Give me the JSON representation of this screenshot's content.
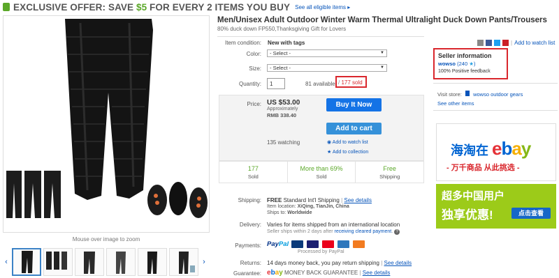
{
  "banner": {
    "prefix": "EXCLUSIVE OFFER: SAVE ",
    "amount": "$5",
    "suffix": " FOR EVERY 2 ITEMS YOU BUY",
    "link": "See all eligible items ▸"
  },
  "gallery": {
    "zoom_hint": "Mouse over image to zoom",
    "thumb_count": 7,
    "selected_thumb": 0
  },
  "item": {
    "title": "Men/Unisex Adult Outdoor Winter Warm Thermal Ultralight Duck Down Pants/Trousers",
    "subtitle": "80% duck down FP550,Thanksgiving Gift for Lovers",
    "share_watch": "Add to watch list",
    "condition_label": "Item condition:",
    "condition_value": "New with tags",
    "color_label": "Color:",
    "color_value": "- Select -",
    "size_label": "Size:",
    "size_value": "- Select -",
    "quantity_label": "Quantity:",
    "quantity_value": "1",
    "available": "81 available",
    "sold": "177 sold"
  },
  "price": {
    "label": "Price:",
    "value": "US $53.00",
    "approx": "Approximately",
    "rmb": "RMB 338.40",
    "buy_now": "Buy It Now",
    "add_to_cart": "Add to cart",
    "watching": "135 watching",
    "add_watch": "Add to watch list",
    "add_collection": "Add to collection"
  },
  "stats": [
    {
      "n": "177",
      "t": "Sold"
    },
    {
      "n": "More than 69%",
      "t": "Sold"
    },
    {
      "n": "Free",
      "t": "Shipping"
    }
  ],
  "shipping": {
    "label": "Shipping:",
    "free": "FREE",
    "method": "Standard Int'l Shipping",
    "details": "See details",
    "location_label": "Item location:",
    "location": "XiQing, TianJin, China",
    "ships_to_label": "Ships to:",
    "ships_to": "Worldwide"
  },
  "delivery": {
    "label": "Delivery:",
    "line1": "Varies for items shipped from an international location",
    "line2_prefix": "Seller ships within 2 days after ",
    "line2_link": "receiving cleared payment",
    "line2_suffix": "."
  },
  "payments": {
    "label": "Payments:",
    "paypal": "Pay",
    "paypal2": "Pal",
    "processed": "Processed by PayPal"
  },
  "returns": {
    "label": "Returns:",
    "text": "14 days money back, you pay return shipping",
    "details": "See details"
  },
  "guarantee": {
    "label": "Guarantee:",
    "text": "MONEY BACK GUARANTEE",
    "details": "See details"
  },
  "seller": {
    "heading": "Seller information",
    "name": "wowso",
    "score": "(240",
    "score_end": ")",
    "feedback": "100% Positive feedback",
    "visit_label": "Visit store:",
    "store_name": "wowso outdoor gears",
    "see_other": "See other items"
  },
  "ads": {
    "ad1_cn": "海淘在",
    "ad1_ebay": "ebay",
    "ad1_sub": "- 万千商品 从此挑选 -",
    "ad2_line1": "超多中国用户",
    "ad2_line2": "独享优惠!",
    "ad2_btn": "点击查看"
  },
  "colors": {
    "link": "#0654ba",
    "buy_button": "#1473e6",
    "highlight_red": "#d9262c",
    "accent_green": "#5ba829"
  }
}
